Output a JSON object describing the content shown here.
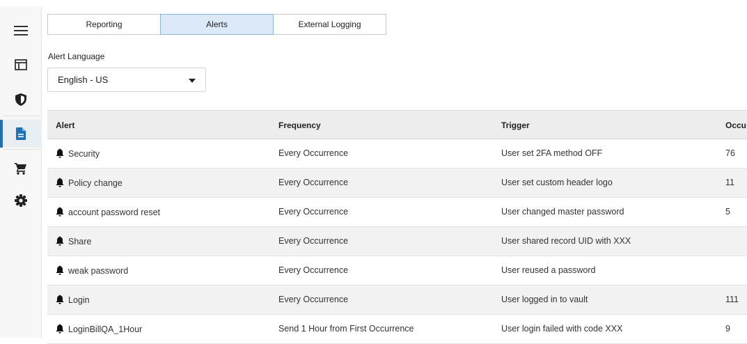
{
  "sidebar": {
    "items": [
      {
        "name": "menu-icon"
      },
      {
        "name": "layout-icon"
      },
      {
        "name": "shield-icon"
      },
      {
        "name": "document-icon",
        "active": true
      },
      {
        "name": "cart-icon"
      },
      {
        "name": "gear-icon"
      }
    ]
  },
  "tabs": [
    {
      "label": "Reporting"
    },
    {
      "label": "Alerts",
      "active": true
    },
    {
      "label": "External Logging"
    }
  ],
  "language": {
    "label": "Alert Language",
    "selected": "English - US"
  },
  "table": {
    "headers": [
      "Alert",
      "Frequency",
      "Trigger",
      "Occu"
    ],
    "rows": [
      {
        "alert": "Security",
        "frequency": "Every Occurrence",
        "trigger": "User set 2FA method OFF",
        "occurrences": "76"
      },
      {
        "alert": "Policy change",
        "frequency": "Every Occurrence",
        "trigger": "User set custom header logo",
        "occurrences": "11"
      },
      {
        "alert": "account password reset",
        "frequency": "Every Occurrence",
        "trigger": "User changed master password",
        "occurrences": "5"
      },
      {
        "alert": "Share",
        "frequency": "Every Occurrence",
        "trigger": "User shared record UID with XXX",
        "occurrences": ""
      },
      {
        "alert": "weak password",
        "frequency": "Every Occurrence",
        "trigger": "User reused a password",
        "occurrences": ""
      },
      {
        "alert": "Login",
        "frequency": "Every Occurrence",
        "trigger": "User logged in to vault",
        "occurrences": "111"
      },
      {
        "alert": "LoginBillQA_1Hour",
        "frequency": "Send 1 Hour from First Occurrence",
        "trigger": "User login failed with code XXX",
        "occurrences": "9"
      }
    ]
  },
  "colors": {
    "accent": "#1f6fb4",
    "tab_active_bg": "#dbe9f7"
  }
}
